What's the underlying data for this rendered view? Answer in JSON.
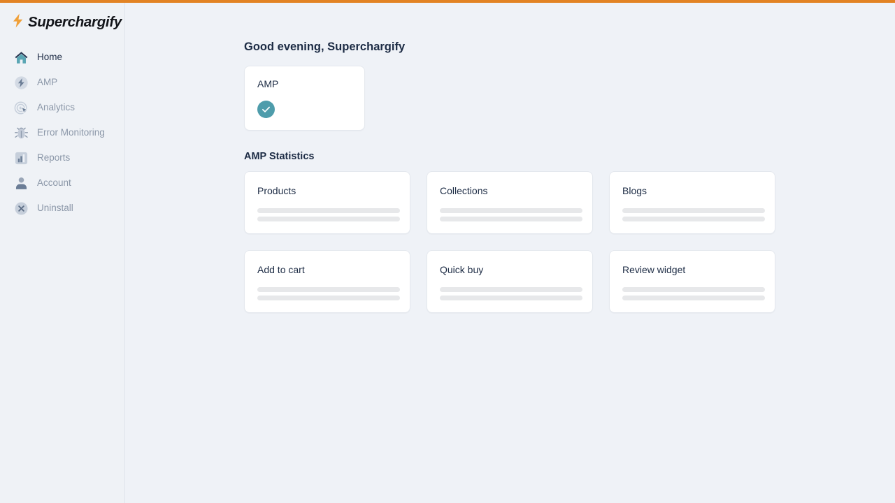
{
  "theme": {
    "accent_orange": "#e28324",
    "page_background": "#eff2f7",
    "sidebar_background": "#eff2f6",
    "card_background": "#ffffff",
    "heading_color": "#1c2b44",
    "nav_label_color": "#8b97a8",
    "nav_active_color": "#223049",
    "check_badge_color": "#4e9cab",
    "skeleton_color": "#e7e8ea"
  },
  "sidebar": {
    "logo": {
      "text": "Superchargify",
      "icon": "lightning-bolt-icon"
    },
    "items": [
      {
        "label": "Home",
        "icon": "home-icon",
        "active": true
      },
      {
        "label": "AMP",
        "icon": "amp-bolt-icon",
        "active": false
      },
      {
        "label": "Analytics",
        "icon": "analytics-cursor-icon",
        "active": false
      },
      {
        "label": "Error Monitoring",
        "icon": "bug-icon",
        "active": false
      },
      {
        "label": "Reports",
        "icon": "bar-chart-icon",
        "active": false
      },
      {
        "label": "Account",
        "icon": "user-icon",
        "active": false
      },
      {
        "label": "Uninstall",
        "icon": "close-circle-icon",
        "active": false
      }
    ]
  },
  "main": {
    "greeting": "Good evening, Superchargify",
    "amp_card": {
      "title": "AMP",
      "status_icon": "check-circle-icon"
    },
    "statistics": {
      "section_title": "AMP Statistics",
      "cards": [
        {
          "title": "Products"
        },
        {
          "title": "Collections"
        },
        {
          "title": "Blogs"
        },
        {
          "title": "Add to cart"
        },
        {
          "title": "Quick buy"
        },
        {
          "title": "Review widget"
        }
      ]
    }
  }
}
